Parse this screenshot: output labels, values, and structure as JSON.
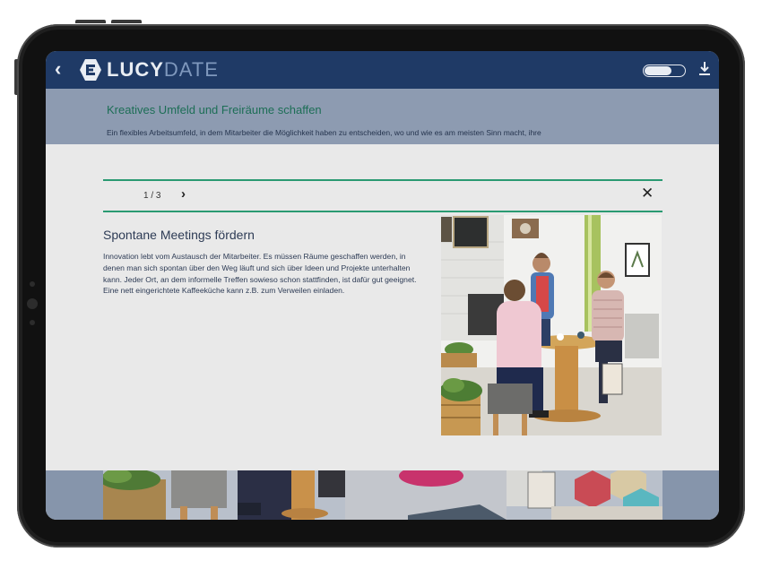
{
  "app": {
    "logo_bold": "LUCY",
    "logo_light": "DATE"
  },
  "icons": {
    "back": "chevron-left-icon",
    "logo": "lucydate-logo",
    "toggle": "toggle-switch",
    "download": "download-icon",
    "next": "chevron-right-icon",
    "close": "close-icon"
  },
  "header": {
    "back_glyph": "‹"
  },
  "banner": {
    "title": "Kreatives Umfeld und Freiräume schaffen",
    "text": "Ein flexibles Arbeitsumfeld, in dem Mitarbeiter die Möglichkeit haben zu entscheiden, wo und wie es am meisten Sinn macht, ihre"
  },
  "slider": {
    "pager": "1 / 3",
    "next_glyph": "›",
    "close_glyph": "✕"
  },
  "article": {
    "heading": "Spontane Meetings fördern",
    "body": "Innovation lebt vom Austausch der Mitarbeiter. Es müssen Räume geschaffen werden, in denen man sich spontan über den Weg läuft und sich über Ideen und Projekte unterhalten kann. Jeder Ort, an dem informelle Treffen sowieso schon stattfinden, ist dafür gut geeignet. Eine nett eingerichtete Kaffeeküche kann z.B. zum Verweilen einladen."
  },
  "colors": {
    "appbar": "#1f3a66",
    "banner": "#8d9bb1",
    "accent_green": "#2a9a72",
    "banner_title": "#1d6e56",
    "text": "#2d3b55"
  }
}
